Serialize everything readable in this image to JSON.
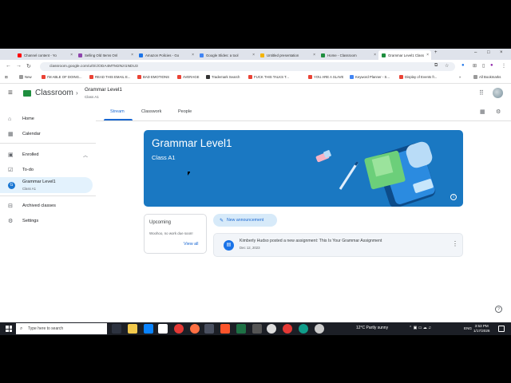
{
  "browser": {
    "tabs": [
      {
        "label": "Channel content - Yo",
        "color": "#ff0000"
      },
      {
        "label": "Selling Old Items Onl",
        "color": "#8e44ad"
      },
      {
        "label": "Amazon Policies - Go",
        "color": "#1a73e8"
      },
      {
        "label": "Google Slides: a tool",
        "color": "#4285f4"
      },
      {
        "label": "Untitled presentation",
        "color": "#f4b400"
      },
      {
        "label": "Home - Classroom",
        "color": "#1e8e3e"
      },
      {
        "label": "Grammar Level1 Class",
        "color": "#1e8e3e"
      }
    ],
    "url": "classroom.google.com/u/0/c/ODA4MTM2NzI1NDU3",
    "bookmarks": [
      "New",
      "I'M ABLE OF DOING...",
      "READ THIS EMAIL E...",
      "BAD EMOTIONS",
      "AVERAGE",
      "Trademark Search",
      "FUCK THIS TALKS T...",
      "YOU ARE A SLAVE",
      "Keyword Planner - S...",
      "Display of Events fr..."
    ],
    "all_bookmarks": "All Bookmarks"
  },
  "header": {
    "app_name": "Classroom",
    "class_name": "Grammar Level1",
    "section": "Class A1"
  },
  "nav": {
    "tabs": [
      "Stream",
      "Classwork",
      "People"
    ]
  },
  "sidebar": {
    "home": "Home",
    "calendar": "Calendar",
    "enrolled": "Enrolled",
    "todo": "To-do",
    "class_item": {
      "badge": "G",
      "name": "Grammar Level1",
      "section": "Class A1"
    },
    "archived": "Archived classes",
    "settings": "Settings"
  },
  "banner": {
    "title": "Grammar Level1",
    "subtitle": "Class A1",
    "color": "#1a78c2"
  },
  "upcoming": {
    "title": "Upcoming",
    "note": "Woohoo, no work due soon!",
    "link": "View all"
  },
  "stream": {
    "announce_label": "New announcement",
    "post": {
      "title": "Kimberly Hudso posted a new assignment: This Is Your Grammar Assignment",
      "date": "Dec 12, 2023"
    }
  },
  "taskbar": {
    "search_placeholder": "Type here to search",
    "weather": "12°C  Partly sunny",
    "lang": "ENG",
    "time": "3:53 PM",
    "date": "1/17/2026"
  }
}
